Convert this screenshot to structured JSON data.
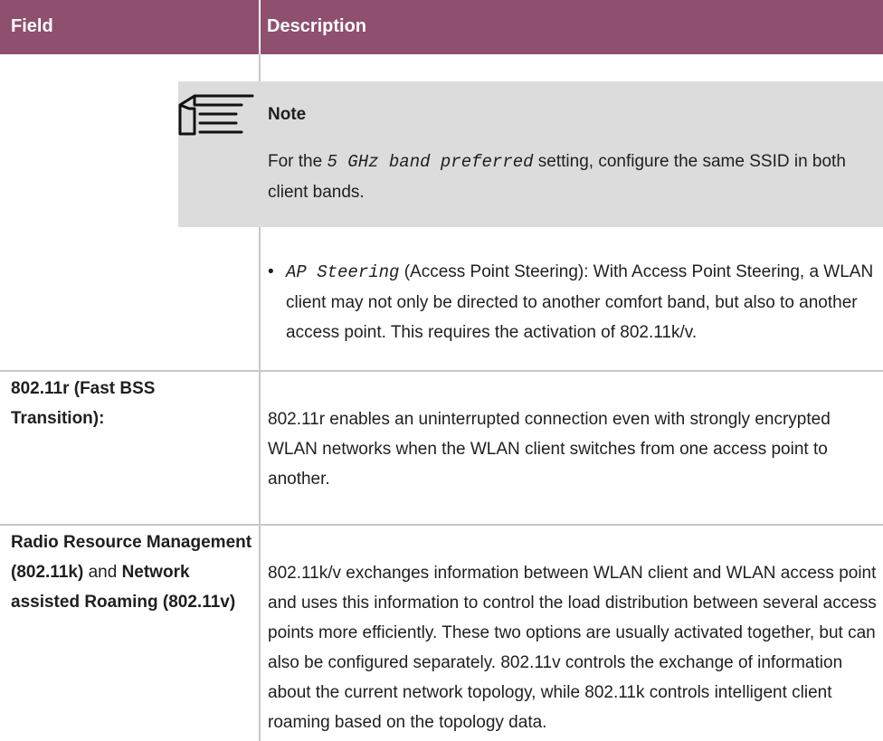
{
  "header": {
    "field": "Field",
    "description": "Description"
  },
  "note": {
    "title": "Note",
    "text_before": "For the ",
    "code": "5 GHz band preferred",
    "text_after": " setting, configure the same SSID in both client bands."
  },
  "steering": {
    "bullet": "•",
    "code": "AP Steering",
    "text": " (Access Point Steering): With Access Point Steering, a WLAN client may not only be directed to another comfort band, but also to another access point. This requires the activation of 802.11k/v."
  },
  "rows": [
    {
      "field": "802.11r (Fast BSS Transition):",
      "description": "802.11r enables an uninterrupted connection even with strongly encrypted WLAN networks when the WLAN client switches from one access point to another."
    },
    {
      "field_part1": "Radio Resource Management (802.11k)",
      "field_and": " and ",
      "field_part2": "Network assisted Roaming (802.11v)",
      "description": "802.11k/v exchanges information between WLAN client and WLAN access point and uses this information to control the load distribution between several access points more efficiently. These two options are usually activated together, but can also be configured separately. 802.11v controls the exchange of information about the current network topology, while 802.11k controls intelligent client roaming based on the topology data."
    }
  ]
}
